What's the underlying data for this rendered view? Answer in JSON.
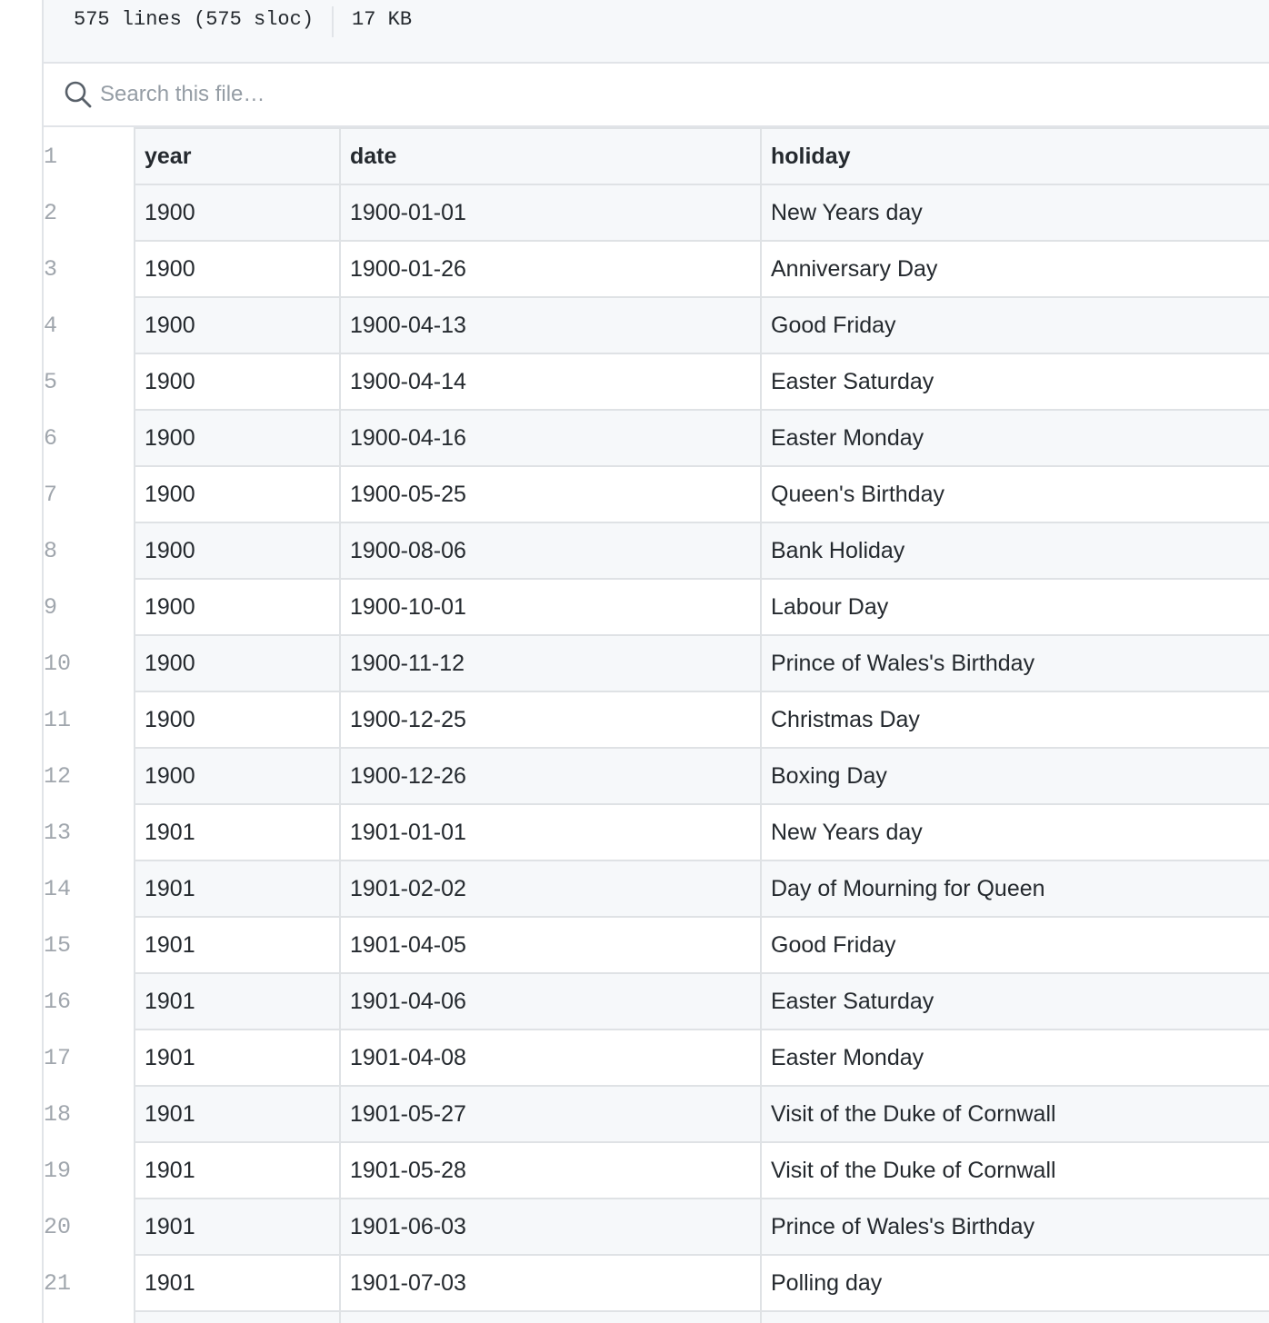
{
  "file_info": {
    "lines": "575 lines (575 sloc)",
    "size": "17 KB"
  },
  "search": {
    "placeholder": "Search this file…"
  },
  "table": {
    "header": {
      "line": "1",
      "cols": [
        "year",
        "date",
        "holiday"
      ]
    },
    "rows": [
      {
        "line": "2",
        "cells": [
          "1900",
          "1900-01-01",
          "New Years day"
        ]
      },
      {
        "line": "3",
        "cells": [
          "1900",
          "1900-01-26",
          "Anniversary Day"
        ]
      },
      {
        "line": "4",
        "cells": [
          "1900",
          "1900-04-13",
          "Good Friday"
        ]
      },
      {
        "line": "5",
        "cells": [
          "1900",
          "1900-04-14",
          "Easter Saturday"
        ]
      },
      {
        "line": "6",
        "cells": [
          "1900",
          "1900-04-16",
          "Easter Monday"
        ]
      },
      {
        "line": "7",
        "cells": [
          "1900",
          "1900-05-25",
          "Queen's Birthday"
        ]
      },
      {
        "line": "8",
        "cells": [
          "1900",
          "1900-08-06",
          "Bank Holiday"
        ]
      },
      {
        "line": "9",
        "cells": [
          "1900",
          "1900-10-01",
          "Labour Day"
        ]
      },
      {
        "line": "10",
        "cells": [
          "1900",
          "1900-11-12",
          "Prince of Wales's Birthday"
        ]
      },
      {
        "line": "11",
        "cells": [
          "1900",
          "1900-12-25",
          "Christmas Day"
        ]
      },
      {
        "line": "12",
        "cells": [
          "1900",
          "1900-12-26",
          "Boxing Day"
        ]
      },
      {
        "line": "13",
        "cells": [
          "1901",
          "1901-01-01",
          "New Years day"
        ]
      },
      {
        "line": "14",
        "cells": [
          "1901",
          "1901-02-02",
          "Day of Mourning for Queen"
        ]
      },
      {
        "line": "15",
        "cells": [
          "1901",
          "1901-04-05",
          "Good Friday"
        ]
      },
      {
        "line": "16",
        "cells": [
          "1901",
          "1901-04-06",
          "Easter Saturday"
        ]
      },
      {
        "line": "17",
        "cells": [
          "1901",
          "1901-04-08",
          "Easter Monday"
        ]
      },
      {
        "line": "18",
        "cells": [
          "1901",
          "1901-05-27",
          "Visit of the Duke of Cornwall"
        ]
      },
      {
        "line": "19",
        "cells": [
          "1901",
          "1901-05-28",
          "Visit of the Duke of Cornwall"
        ]
      },
      {
        "line": "20",
        "cells": [
          "1901",
          "1901-06-03",
          "Prince of Wales's Birthday"
        ]
      },
      {
        "line": "21",
        "cells": [
          "1901",
          "1901-07-03",
          "Polling day"
        ]
      },
      {
        "line": "",
        "cells": [
          "",
          "",
          ""
        ]
      }
    ]
  }
}
